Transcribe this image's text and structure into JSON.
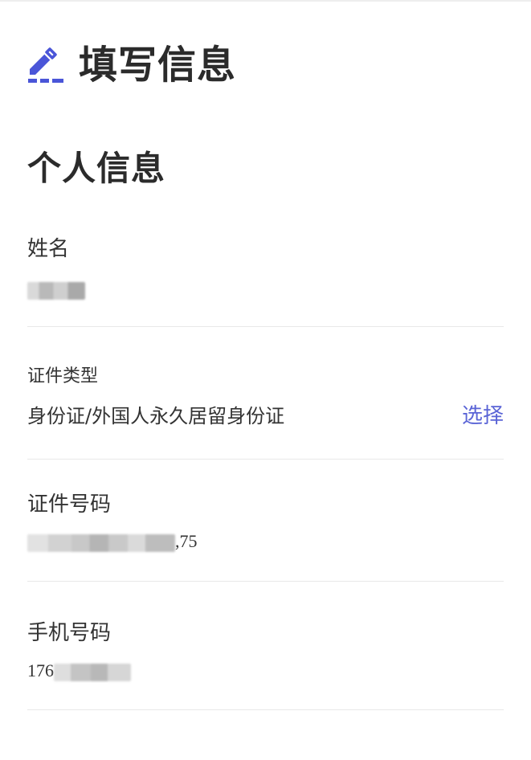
{
  "header": {
    "title": "填写信息",
    "icon": "edit-icon",
    "accent_color": "#4a55d8"
  },
  "section": {
    "title": "个人信息"
  },
  "fields": {
    "name": {
      "label": "姓名",
      "value": ""
    },
    "id_type": {
      "label": "证件类型",
      "value": "身份证/外国人永久居留身份证",
      "action_label": "选择"
    },
    "id_number": {
      "label": "证件号码",
      "value_visible_suffix": ",75"
    },
    "phone": {
      "label": "手机号码",
      "value_visible_prefix": "176"
    }
  }
}
